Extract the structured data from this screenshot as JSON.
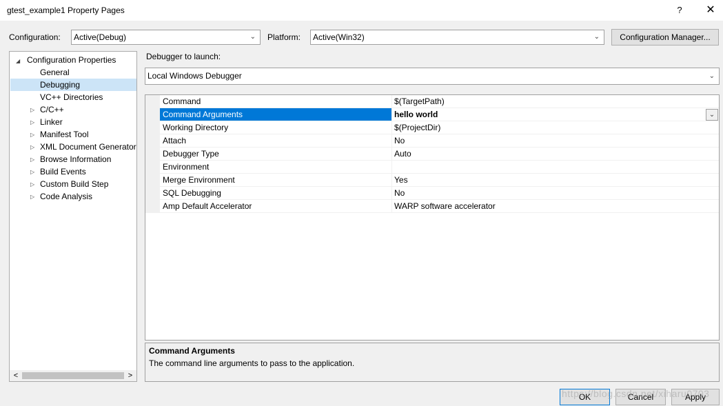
{
  "window": {
    "title": "gtest_example1 Property Pages",
    "help_label": "?",
    "close_label": "✕"
  },
  "config": {
    "configuration_label": "Configuration:",
    "configuration_value": "Active(Debug)",
    "platform_label": "Platform:",
    "platform_value": "Active(Win32)",
    "manager_button": "Configuration Manager..."
  },
  "tree": {
    "root": "Configuration Properties",
    "items": [
      {
        "label": "General",
        "expandable": false
      },
      {
        "label": "Debugging",
        "expandable": false,
        "selected": true
      },
      {
        "label": "VC++ Directories",
        "expandable": false
      },
      {
        "label": "C/C++",
        "expandable": true
      },
      {
        "label": "Linker",
        "expandable": true
      },
      {
        "label": "Manifest Tool",
        "expandable": true
      },
      {
        "label": "XML Document Generator",
        "expandable": true
      },
      {
        "label": "Browse Information",
        "expandable": true
      },
      {
        "label": "Build Events",
        "expandable": true
      },
      {
        "label": "Custom Build Step",
        "expandable": true
      },
      {
        "label": "Code Analysis",
        "expandable": true
      }
    ],
    "scroll_left": "<",
    "scroll_right": ">"
  },
  "debugger": {
    "launch_label": "Debugger to launch:",
    "launch_value": "Local Windows Debugger"
  },
  "properties": [
    {
      "name": "Command",
      "value": "$(TargetPath)"
    },
    {
      "name": "Command Arguments",
      "value": "hello world",
      "selected": true
    },
    {
      "name": "Working Directory",
      "value": "$(ProjectDir)"
    },
    {
      "name": "Attach",
      "value": "No"
    },
    {
      "name": "Debugger Type",
      "value": "Auto"
    },
    {
      "name": "Environment",
      "value": ""
    },
    {
      "name": "Merge Environment",
      "value": "Yes"
    },
    {
      "name": "SQL Debugging",
      "value": "No"
    },
    {
      "name": "Amp Default Accelerator",
      "value": "WARP software accelerator"
    }
  ],
  "description": {
    "title": "Command Arguments",
    "text": "The command line arguments to pass to the application."
  },
  "buttons": {
    "ok": "OK",
    "cancel": "Cancel",
    "apply": "Apply"
  },
  "watermark": "https://blog.csdn.net/xiharu0703"
}
